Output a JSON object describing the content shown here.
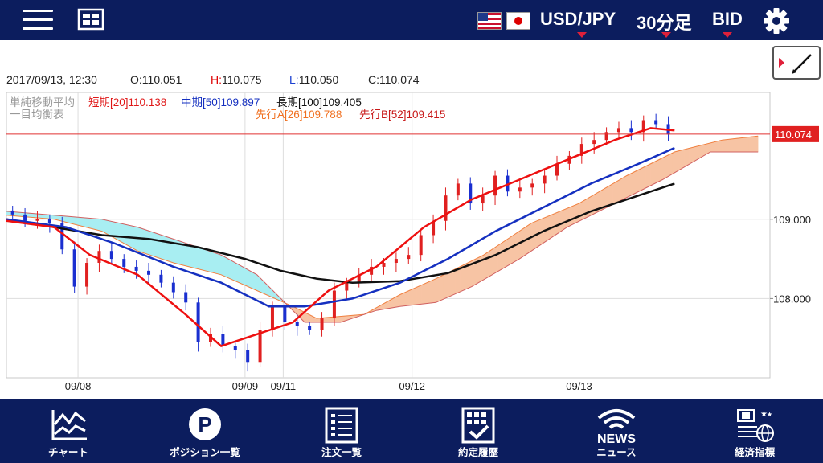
{
  "header": {
    "pair": "USD/JPY",
    "timeframe": "30分足",
    "price_type": "BID"
  },
  "ohlc": {
    "datetime": "2017/09/13, 12:30",
    "open_label": "O:",
    "open": "110.051",
    "high_label": "H:",
    "high": "110.075",
    "low_label": "L:",
    "low": "110.050",
    "close_label": "C:",
    "close": "110.074"
  },
  "legend": {
    "sma_title": "単純移動平均",
    "short": "短期[20]110.138",
    "mid": "中期[50]109.897",
    "long": "長期[100]109.405",
    "ichimoku_title": "一目均衡表",
    "span_a": "先行A[26]109.788",
    "span_b": "先行B[52]109.415"
  },
  "current_price": "110.074",
  "colors": {
    "bull": "#e02020",
    "bear": "#1a2fd0",
    "sma_short": "#ee1010",
    "sma_mid": "#1530c0",
    "sma_long": "#111111",
    "cloud_bull": "#f7c4a4",
    "cloud_bear": "#a8eef2",
    "span_a": "#f08040",
    "nav_bg": "#0c1d5e"
  },
  "nav": {
    "chart": "チャート",
    "position": "ポジション一覧",
    "orders": "注文一覧",
    "history": "約定履歴",
    "news_word": "NEWS",
    "news": "ニュース",
    "indicators": "経済指標"
  },
  "chart_data": {
    "type": "candlestick",
    "y_ticks": [
      "110.074",
      "109.000",
      "108.000"
    ],
    "ylim": [
      107.0,
      110.6
    ],
    "x_ticks": [
      {
        "label": "09/08",
        "x": 30
      },
      {
        "label": "09/09",
        "x": 100
      },
      {
        "label": "09/11",
        "x": 116
      },
      {
        "label": "09/12",
        "x": 170
      },
      {
        "label": "09/13",
        "x": 240
      }
    ],
    "grid": true,
    "x_range": [
      0,
      320
    ],
    "closes": [
      109.06,
      108.98,
      109.0,
      108.95,
      108.62,
      108.15,
      108.45,
      108.6,
      108.5,
      108.4,
      108.35,
      108.3,
      108.2,
      108.08,
      107.95,
      107.45,
      107.55,
      107.4,
      107.35,
      107.2,
      107.6,
      107.9,
      107.7,
      107.65,
      107.6,
      107.75,
      108.1,
      108.2,
      108.3,
      108.4,
      108.45,
      108.5,
      108.55,
      108.8,
      108.98,
      109.3,
      109.45,
      109.2,
      109.3,
      109.55,
      109.35,
      109.4,
      109.45,
      109.55,
      109.7,
      109.8,
      109.95,
      110.0,
      110.1,
      110.15,
      110.1,
      110.25,
      110.2,
      110.07
    ],
    "sma_short": [
      [
        0,
        108.98
      ],
      [
        20,
        108.9
      ],
      [
        35,
        108.55
      ],
      [
        55,
        108.3
      ],
      [
        75,
        107.8
      ],
      [
        90,
        107.4
      ],
      [
        105,
        107.55
      ],
      [
        120,
        107.7
      ],
      [
        135,
        108.1
      ],
      [
        155,
        108.4
      ],
      [
        175,
        108.9
      ],
      [
        195,
        109.25
      ],
      [
        215,
        109.5
      ],
      [
        235,
        109.75
      ],
      [
        255,
        110.0
      ],
      [
        270,
        110.15
      ],
      [
        280,
        110.12
      ]
    ],
    "sma_mid": [
      [
        0,
        109.0
      ],
      [
        25,
        108.9
      ],
      [
        45,
        108.7
      ],
      [
        70,
        108.4
      ],
      [
        90,
        108.2
      ],
      [
        110,
        107.9
      ],
      [
        125,
        107.9
      ],
      [
        145,
        108.0
      ],
      [
        165,
        108.2
      ],
      [
        185,
        108.5
      ],
      [
        205,
        108.85
      ],
      [
        225,
        109.15
      ],
      [
        245,
        109.45
      ],
      [
        265,
        109.7
      ],
      [
        280,
        109.9
      ]
    ],
    "sma_long": [
      [
        0,
        109.0
      ],
      [
        20,
        108.9
      ],
      [
        40,
        108.8
      ],
      [
        60,
        108.75
      ],
      [
        80,
        108.65
      ],
      [
        100,
        108.5
      ],
      [
        115,
        108.35
      ],
      [
        130,
        108.25
      ],
      [
        145,
        108.2
      ],
      [
        165,
        108.22
      ],
      [
        185,
        108.32
      ],
      [
        205,
        108.55
      ],
      [
        225,
        108.85
      ],
      [
        245,
        109.1
      ],
      [
        265,
        109.3
      ],
      [
        280,
        109.45
      ]
    ],
    "span_a": [
      [
        0,
        109.05
      ],
      [
        20,
        109.0
      ],
      [
        40,
        108.85
      ],
      [
        55,
        108.6
      ],
      [
        70,
        108.45
      ],
      [
        90,
        108.3
      ],
      [
        105,
        108.1
      ],
      [
        120,
        107.9
      ],
      [
        130,
        107.75
      ],
      [
        150,
        107.8
      ],
      [
        165,
        108.05
      ],
      [
        180,
        108.25
      ],
      [
        200,
        108.55
      ],
      [
        220,
        108.95
      ],
      [
        240,
        109.2
      ],
      [
        260,
        109.55
      ],
      [
        280,
        109.85
      ],
      [
        300,
        110.0
      ],
      [
        315,
        110.05
      ]
    ],
    "span_b": [
      [
        0,
        109.1
      ],
      [
        20,
        109.05
      ],
      [
        40,
        109.0
      ],
      [
        55,
        108.9
      ],
      [
        70,
        108.75
      ],
      [
        90,
        108.55
      ],
      [
        105,
        108.3
      ],
      [
        115,
        108.0
      ],
      [
        125,
        107.7
      ],
      [
        140,
        107.7
      ],
      [
        155,
        107.85
      ],
      [
        165,
        107.9
      ],
      [
        180,
        107.95
      ],
      [
        195,
        108.15
      ],
      [
        215,
        108.5
      ],
      [
        235,
        108.9
      ],
      [
        255,
        109.2
      ],
      [
        275,
        109.5
      ],
      [
        295,
        109.85
      ],
      [
        315,
        109.85
      ]
    ]
  }
}
